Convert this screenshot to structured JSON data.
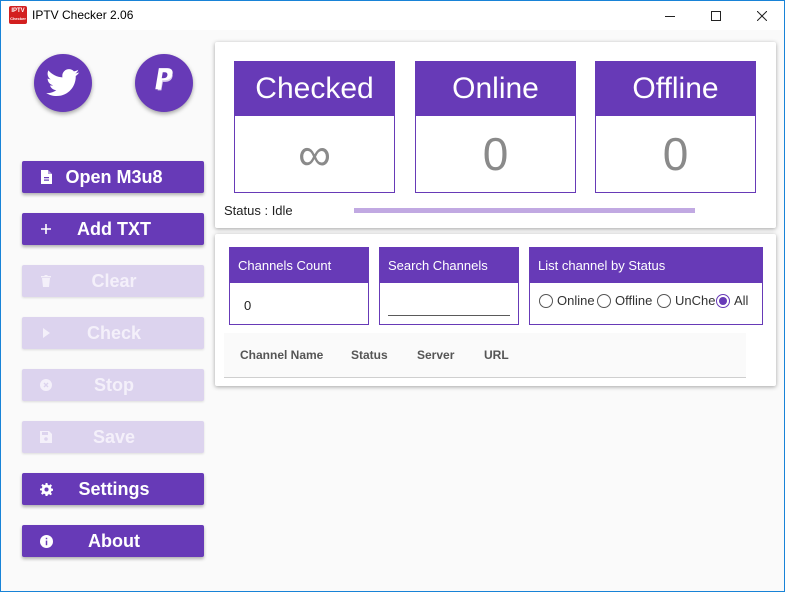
{
  "window": {
    "title": "IPTV Checker 2.06",
    "icon_text_top": "IPTV",
    "icon_text_bottom": "Checker"
  },
  "sidebar": {
    "social": [
      {
        "name": "twitter",
        "icon": "twitter-bird-icon"
      },
      {
        "name": "paypal",
        "icon": "paypal-icon"
      }
    ],
    "buttons": [
      {
        "label": "Open M3u8",
        "icon": "file-icon",
        "enabled": true
      },
      {
        "label": "Add TXT",
        "icon": "plus-icon",
        "enabled": true
      },
      {
        "label": "Clear",
        "icon": "trash-icon",
        "enabled": false
      },
      {
        "label": "Check",
        "icon": "play-icon",
        "enabled": false
      },
      {
        "label": "Stop",
        "icon": "cancel-icon",
        "enabled": false
      },
      {
        "label": "Save",
        "icon": "floppy-icon",
        "enabled": false
      },
      {
        "label": "Settings",
        "icon": "gear-icon",
        "enabled": true
      },
      {
        "label": "About",
        "icon": "info-icon",
        "enabled": true
      }
    ]
  },
  "stats": {
    "checked": {
      "label": "Checked",
      "value": "∞"
    },
    "online": {
      "label": "Online",
      "value": "0"
    },
    "offline": {
      "label": "Offline",
      "value": "0"
    },
    "status_text": "Status : Idle"
  },
  "channels": {
    "count_header": "Channels Count",
    "count_value": "0",
    "search_header": "Search Channels",
    "search_value": "",
    "filter_header": "List channel by Status",
    "filter_options": [
      "Online",
      "Offline",
      "UnChe",
      "All"
    ],
    "filter_selected": "All"
  },
  "table": {
    "columns": [
      "Channel Name",
      "Status",
      "Server",
      "URL"
    ]
  },
  "colors": {
    "accent": "#673ab7",
    "disabled": "#dcd3ee",
    "progress": "#c1a9e2"
  }
}
